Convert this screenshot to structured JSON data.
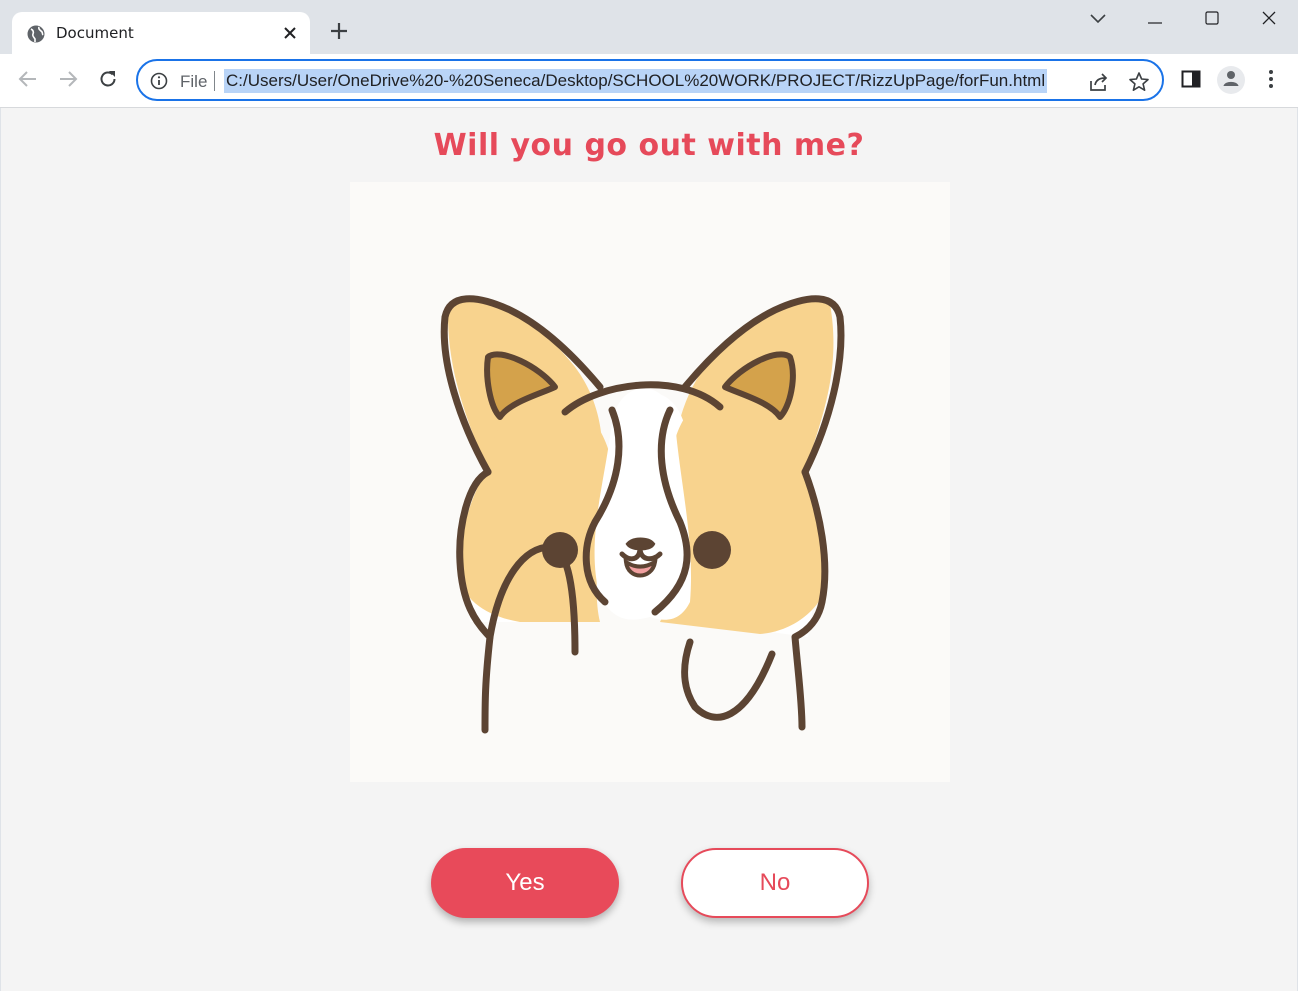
{
  "browser": {
    "tab": {
      "title": "Document"
    },
    "address_bar": {
      "scheme_label": "File",
      "url": "C:/Users/User/OneDrive%20-%20Seneca/Desktop/SCHOOL%20WORK/PROJECT/RizzUpPage/forFun.html"
    },
    "icons": {
      "tab": "globe-icon",
      "close": "close-icon",
      "new_tab": "plus-icon",
      "back": "back-arrow-icon",
      "forward": "forward-arrow-icon",
      "reload": "reload-icon",
      "site_info": "info-icon",
      "share": "share-icon",
      "bookmark": "star-icon",
      "side_panel": "side-panel-icon",
      "profile": "profile-icon",
      "menu": "kebab-menu-icon"
    }
  },
  "page": {
    "question": "Will you go out with me?",
    "image": "corgi-waving-illustration",
    "buttons": {
      "yes": "Yes",
      "no": "No"
    }
  },
  "colors": {
    "accent": "#e84a5a",
    "page_bg": "#f4f4f4",
    "focus_ring": "#1a73e8"
  }
}
